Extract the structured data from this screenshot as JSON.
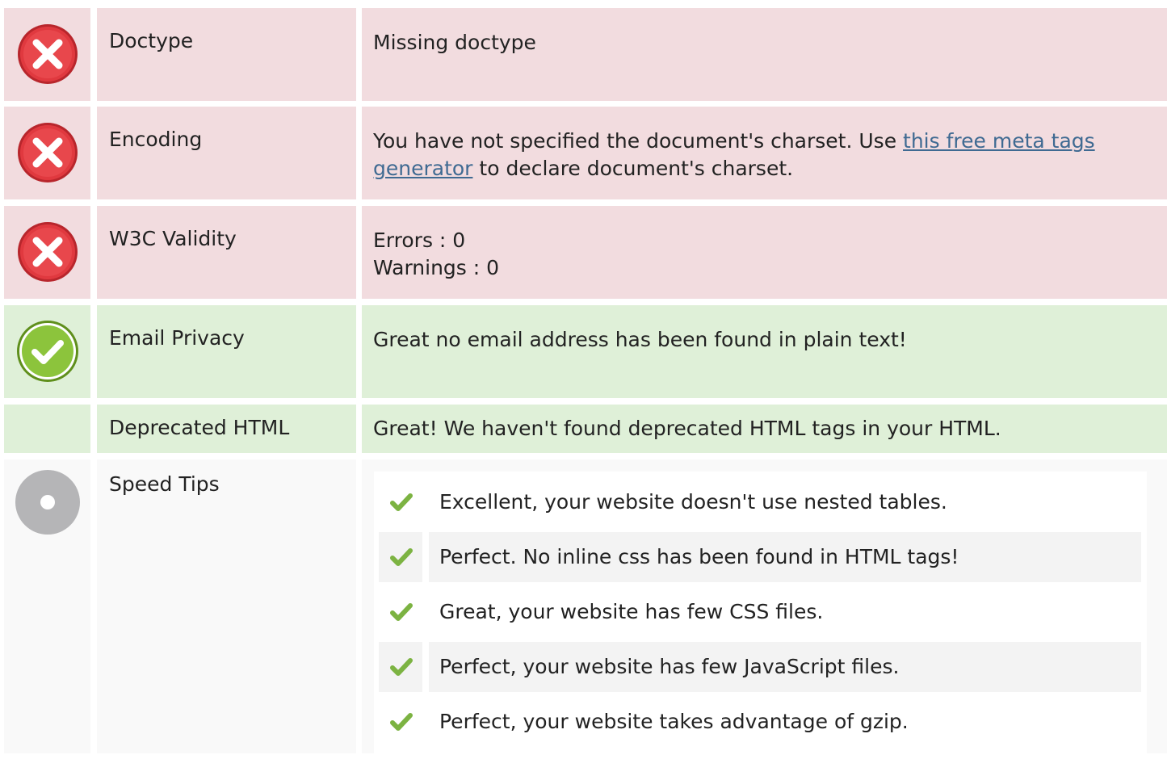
{
  "rows": [
    {
      "status": "error",
      "label": "Doctype",
      "value": "Missing doctype"
    },
    {
      "status": "error",
      "label": "Encoding",
      "value_before": "You have not specified the document's charset. Use ",
      "link_text": "this free meta tags generator",
      "value_after": " to declare document's charset."
    },
    {
      "status": "error",
      "label": "W3C Validity",
      "lines": [
        "Errors : 0",
        "Warnings : 0"
      ]
    },
    {
      "status": "success",
      "label": "Email Privacy",
      "value": "Great no email address has been found in plain text!"
    },
    {
      "status": "success",
      "label": "Deprecated HTML",
      "value": "Great! We haven't found deprecated HTML tags in your HTML."
    },
    {
      "status": "neutral",
      "label": "Speed Tips",
      "tips": [
        "Excellent, your website doesn't use nested tables.",
        "Perfect. No inline css has been found in HTML tags!",
        "Great, your website has few CSS files.",
        "Perfect, your website has few JavaScript files.",
        "Perfect, your website takes advantage of gzip."
      ]
    }
  ],
  "icons": {
    "error": "error-x-icon",
    "success": "success-check-icon",
    "neutral": "info-dot-icon",
    "tip": "checkmark-icon"
  },
  "colors": {
    "error_bg": "#f2dcdf",
    "success_bg": "#dff0d8",
    "neutral_bg": "#f9f9f9",
    "error_icon": "#e0393f",
    "success_icon": "#8cc43c",
    "neutral_icon": "#b5b5b7",
    "link": "#3f6a92"
  }
}
